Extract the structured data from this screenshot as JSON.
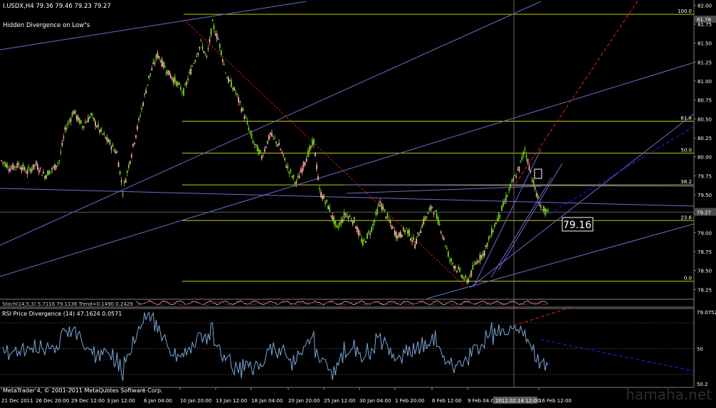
{
  "window": {
    "symbol_line": "I.USDX,H4  79.36 79.46 79.23 79.27",
    "indicator_label": "Hidden Divergence on Low\"s",
    "footer": "MetaTrader 4, © 2001-2011 MetaQuotes Software Corp.",
    "watermark": "hamaha.net",
    "big_price_label": "79.16",
    "current_price_tag": "79.27",
    "top_price_tag": "81.78",
    "timestamp_tag": "2012.02.14 12:00"
  },
  "colors": {
    "background": "#000000",
    "bull_candle": "#6fd316",
    "bear_candle": "#f4a9a0",
    "fib_lines": "#c8c800",
    "trend_lines": "#6b6bd6",
    "red_dashed": "#c21a1a",
    "blue_dashed": "#1a1ad6",
    "rsi_line": "#7aa7d8",
    "grid": "#3a3a3a"
  },
  "chart_data": [
    {
      "type": "candlestick",
      "title": "I.USDX,H4",
      "y_ticks": [
        "82.00",
        "81.75",
        "81.50",
        "81.25",
        "81.00",
        "80.75",
        "80.50",
        "80.25",
        "80.00",
        "79.75",
        "79.50",
        "79.25",
        "79.00",
        "78.75",
        "78.50",
        "78.25"
      ],
      "ylim": [
        78.15,
        82.05
      ],
      "x_ticks": [
        "21 Dec 2011",
        "26 Dec 20:00",
        "29 Dec 12:00",
        "3 Jan 12:00",
        "6 Jan 04:00",
        "10 Jan 20:00",
        "13 Jan 12:00",
        "18 Jan 04:00",
        "20 Jan 20:00",
        "25 Jan 12:00",
        "30 Jan 04:00",
        "1 Feb 20:00",
        "6 Feb 12:00",
        "9 Feb 04:00",
        "16 Feb 12:00"
      ],
      "price_path": [
        [
          0,
          79.95
        ],
        [
          6,
          79.85
        ],
        [
          12,
          79.9
        ],
        [
          18,
          79.8
        ],
        [
          24,
          79.9
        ],
        [
          30,
          79.75
        ],
        [
          36,
          79.85
        ],
        [
          40,
          79.95
        ],
        [
          44,
          80.35
        ],
        [
          50,
          80.6
        ],
        [
          56,
          80.4
        ],
        [
          62,
          80.55
        ],
        [
          68,
          80.35
        ],
        [
          74,
          80.2
        ],
        [
          80,
          80.05
        ],
        [
          84,
          79.55
        ],
        [
          90,
          80.05
        ],
        [
          96,
          80.55
        ],
        [
          102,
          81.05
        ],
        [
          108,
          81.35
        ],
        [
          114,
          81.15
        ],
        [
          120,
          81.0
        ],
        [
          126,
          80.85
        ],
        [
          132,
          81.2
        ],
        [
          138,
          81.5
        ],
        [
          142,
          81.3
        ],
        [
          146,
          81.75
        ],
        [
          150,
          81.55
        ],
        [
          156,
          81.05
        ],
        [
          162,
          80.85
        ],
        [
          168,
          80.55
        ],
        [
          174,
          80.2
        ],
        [
          180,
          80.0
        ],
        [
          186,
          80.3
        ],
        [
          192,
          80.15
        ],
        [
          198,
          79.85
        ],
        [
          204,
          79.65
        ],
        [
          210,
          79.95
        ],
        [
          216,
          80.2
        ],
        [
          220,
          79.55
        ],
        [
          226,
          79.35
        ],
        [
          232,
          79.05
        ],
        [
          238,
          79.25
        ],
        [
          244,
          79.15
        ],
        [
          250,
          78.85
        ],
        [
          256,
          79.05
        ],
        [
          262,
          79.4
        ],
        [
          268,
          79.15
        ],
        [
          274,
          78.95
        ],
        [
          280,
          79.05
        ],
        [
          286,
          78.85
        ],
        [
          292,
          79.15
        ],
        [
          298,
          79.35
        ],
        [
          304,
          79.05
        ],
        [
          310,
          78.65
        ],
        [
          316,
          78.5
        ],
        [
          322,
          78.35
        ],
        [
          328,
          78.6
        ],
        [
          334,
          78.75
        ],
        [
          340,
          79.05
        ],
        [
          346,
          79.3
        ],
        [
          352,
          79.6
        ],
        [
          358,
          79.85
        ],
        [
          362,
          80.1
        ],
        [
          366,
          79.8
        ],
        [
          370,
          79.5
        ],
        [
          374,
          79.3
        ],
        [
          378,
          79.25
        ]
      ],
      "fibonacci": [
        {
          "label": "100.0",
          "value": 81.88
        },
        {
          "label": "61.8",
          "value": 80.47
        },
        {
          "label": "50.0",
          "value": 80.05
        },
        {
          "label": "38.2",
          "value": 79.63
        },
        {
          "label": "23.6",
          "value": 79.16
        },
        {
          "label": "0.0",
          "value": 78.36
        }
      ],
      "horizontal_price_line": 79.27
    },
    {
      "type": "line",
      "title": "Stoch",
      "series_label": "Stoch(14,5,3)  5.7116  79.1136    Trend=0.1490  0.2429"
    },
    {
      "type": "line",
      "title": "RSI Price Divergence",
      "series_label": "RSI Price Divergence (14)  47.1624  0.0571",
      "y_ticks": [
        "79.0752",
        "50",
        "50.2"
      ],
      "ylim": [
        20,
        80
      ]
    }
  ]
}
